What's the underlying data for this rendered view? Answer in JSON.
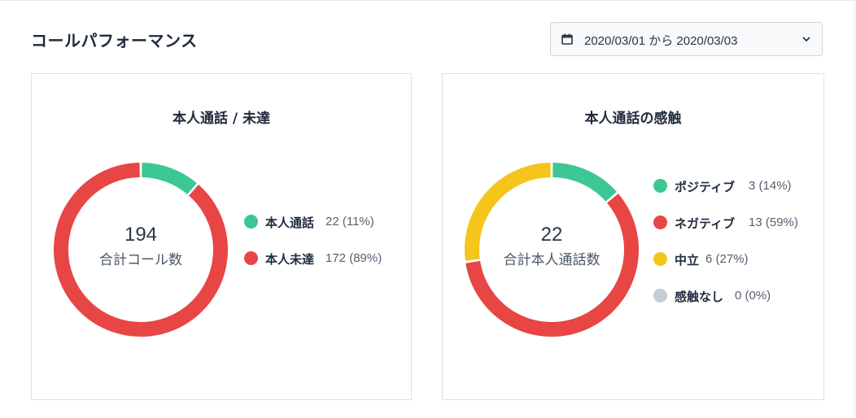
{
  "header": {
    "title": "コールパフォーマンス",
    "date_range": "2020/03/01 から 2020/03/03",
    "icons": [
      "calendar-icon",
      "chevron-down-icon"
    ]
  },
  "chart_data": [
    {
      "type": "donut",
      "title": "本人通話 / 未達",
      "center_value": "194",
      "center_label": "合計コール数",
      "series": [
        {
          "name": "本人通話",
          "value": 22,
          "value_label": "22 (11%)",
          "color": "#3cc793"
        },
        {
          "name": "本人未達",
          "value": 172,
          "value_label": "172 (89%)",
          "color": "#e84545"
        }
      ]
    },
    {
      "type": "donut",
      "title": "本人通話の感触",
      "center_value": "22",
      "center_label": "合計本人通話数",
      "series": [
        {
          "name": "ポジティブ",
          "value": 3,
          "value_label": "3 (14%)",
          "color": "#3cc793"
        },
        {
          "name": "ネガティブ",
          "value": 13,
          "value_label": "13 (59%)",
          "color": "#e84545"
        },
        {
          "name": "中立",
          "value": 6,
          "value_label": "6 (27%)",
          "color": "#f5c51c"
        },
        {
          "name": "感触なし",
          "value": 0,
          "value_label": "0 (0%)",
          "color": "#c4ccd6"
        }
      ]
    }
  ]
}
